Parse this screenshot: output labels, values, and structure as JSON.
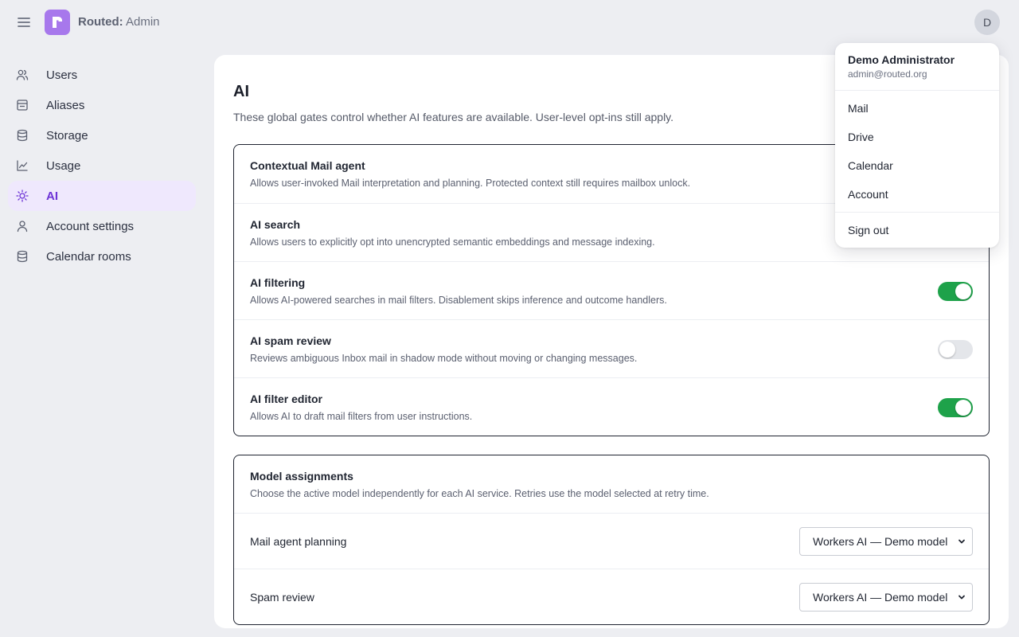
{
  "header": {
    "brand_strong": "Routed:",
    "brand_rest": " Admin",
    "avatar_letter": "D"
  },
  "sidebar": {
    "items": [
      {
        "label": "Users",
        "icon": "users-icon"
      },
      {
        "label": "Aliases",
        "icon": "aliases-icon"
      },
      {
        "label": "Storage",
        "icon": "database-icon"
      },
      {
        "label": "Usage",
        "icon": "chart-line-icon"
      },
      {
        "label": "AI",
        "icon": "sparkle-icon",
        "active": true
      },
      {
        "label": "Account settings",
        "icon": "user-icon"
      },
      {
        "label": "Calendar rooms",
        "icon": "database-icon"
      }
    ]
  },
  "main": {
    "title": "AI",
    "description": "These global gates control whether AI features are available. User-level opt-ins still apply.",
    "gates": [
      {
        "title": "Contextual Mail agent",
        "description": "Allows user-invoked Mail interpretation and planning. Protected context still requires mailbox unlock.",
        "enabled": null
      },
      {
        "title": "AI search",
        "description": "Allows users to explicitly opt into unencrypted semantic embeddings and message indexing.",
        "enabled": null
      },
      {
        "title": "AI filtering",
        "description": "Allows AI-powered searches in mail filters. Disablement skips inference and outcome handlers.",
        "enabled": true
      },
      {
        "title": "AI spam review",
        "description": "Reviews ambiguous Inbox mail in shadow mode without moving or changing messages.",
        "enabled": false
      },
      {
        "title": "AI filter editor",
        "description": "Allows AI to draft mail filters from user instructions.",
        "enabled": true
      }
    ],
    "models": {
      "title": "Model assignments",
      "description": "Choose the active model independently for each AI service. Retries use the model selected at retry time.",
      "rows": [
        {
          "label": "Mail agent planning",
          "selected": "Workers AI — Demo model"
        },
        {
          "label": "Spam review",
          "selected": "Workers AI — Demo model"
        }
      ]
    }
  },
  "dropdown": {
    "name": "Demo Administrator",
    "email": "admin@routed.org",
    "items": [
      "Mail",
      "Drive",
      "Calendar",
      "Account"
    ],
    "signout": "Sign out"
  },
  "colors": {
    "accent": "#6d33d6",
    "logo": "#a778ec",
    "toggle_on": "#1ea24a",
    "toggle_off": "#e4e6ea"
  }
}
